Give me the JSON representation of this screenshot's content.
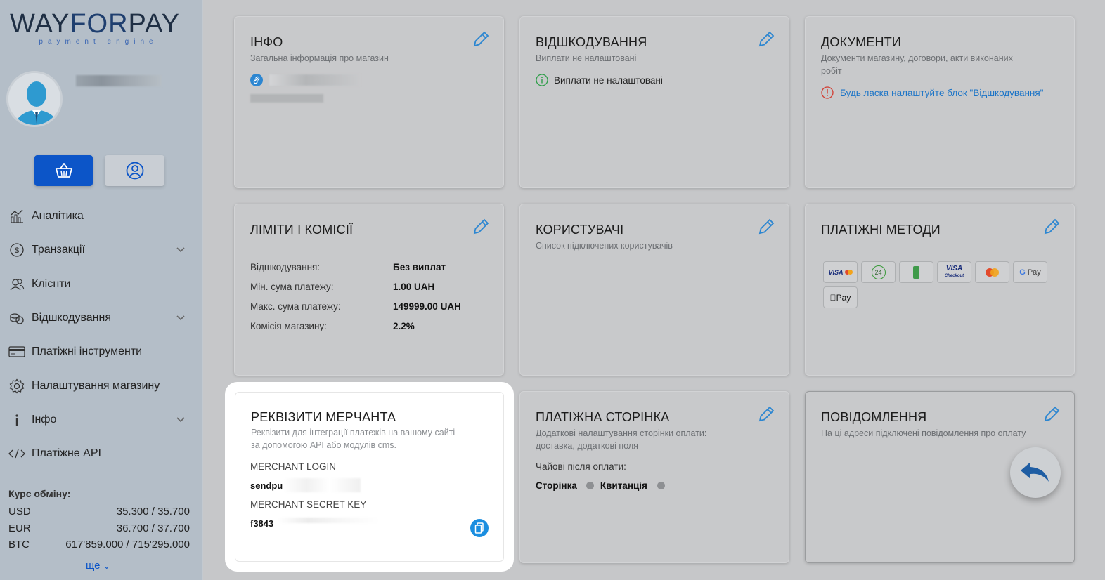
{
  "brand": {
    "name_part1": "WAY",
    "name_part2": "FOR",
    "name_part3": "PAY",
    "tagline": "payment engine"
  },
  "nav": [
    {
      "label": "Аналітика",
      "icon": "analytics-icon",
      "has_chevron": false
    },
    {
      "label": "Транзакції",
      "icon": "dollar-coin-icon",
      "has_chevron": true
    },
    {
      "label": "Клієнти",
      "icon": "users-icon",
      "has_chevron": false
    },
    {
      "label": "Відшкодування",
      "icon": "coins-icon",
      "has_chevron": true
    },
    {
      "label": "Платіжні інструменти",
      "icon": "card-icon",
      "has_chevron": false
    },
    {
      "label": "Налаштування магазину",
      "icon": "gear-icon",
      "has_chevron": false
    },
    {
      "label": "Інфо",
      "icon": "info-icon",
      "has_chevron": true
    },
    {
      "label": "Платіжне API",
      "icon": "code-icon",
      "has_chevron": false
    }
  ],
  "rates": {
    "title": "Курс обміну:",
    "rows": [
      {
        "currency": "USD",
        "value": "35.300 / 35.700"
      },
      {
        "currency": "EUR",
        "value": "36.700 / 37.700"
      },
      {
        "currency": "BTC",
        "value": "617'859.000 / 715'295.000"
      }
    ],
    "more": "ще"
  },
  "cards": {
    "info": {
      "title": "ІНФО",
      "subtitle": "Загальна інформація про магазин"
    },
    "refund": {
      "title": "ВІДШКОДУВАННЯ",
      "subtitle": "Виплати не налаштовані",
      "status": "Виплати не налаштовані"
    },
    "docs": {
      "title": "ДОКУМЕНТИ",
      "subtitle_line1": "Документи магазину, договори, акти виконаних",
      "subtitle_line2": "робіт",
      "warning": "Будь ласка налаштуйте блок \"Відшкодування\""
    },
    "limits": {
      "title": "ЛІМІТИ І КОМІСІЇ",
      "rows": [
        {
          "label": "Відшкодування:",
          "value": "Без виплат"
        },
        {
          "label": "Мін. сума платежу:",
          "value": "1.00 UAH"
        },
        {
          "label": "Макс. сума платежу:",
          "value": "149999.00 UAH"
        },
        {
          "label": "Комісія магазину:",
          "value": "2.2%"
        }
      ]
    },
    "users": {
      "title": "КОРИСТУВАЧІ",
      "subtitle": "Список підключених користувачів"
    },
    "methods": {
      "title": "ПЛАТІЖНІ МЕТОДИ",
      "items": [
        "VISA/Mastercard",
        "24",
        "Terminal",
        "VISA Checkout",
        "Masterpass",
        "G Pay",
        "Pay"
      ]
    },
    "merchant": {
      "title": "РЕКВІЗИТИ МЕРЧАНТА",
      "subtitle_line1": "Реквізити для інтеграції платежів на вашому сайті",
      "subtitle_line2": "за допомогою API або модулів cms.",
      "login_label": "MERCHANT LOGIN",
      "login_value": "sendpu",
      "key_label": "MERCHANT SECRET KEY",
      "key_value": "f3843"
    },
    "paypage": {
      "title": "ПЛАТІЖНА СТОРІНКА",
      "subtitle_line1": "Додаткові налаштування сторінки оплати:",
      "subtitle_line2": "доставка, додаткові поля",
      "tips_label": "Чайові після оплати:",
      "opt1": "Сторінка",
      "opt2": "Квитанція"
    },
    "notify": {
      "title": "ПОВІДОМЛЕННЯ",
      "subtitle": "На ці адреси підключені повідомлення про оплату"
    }
  }
}
